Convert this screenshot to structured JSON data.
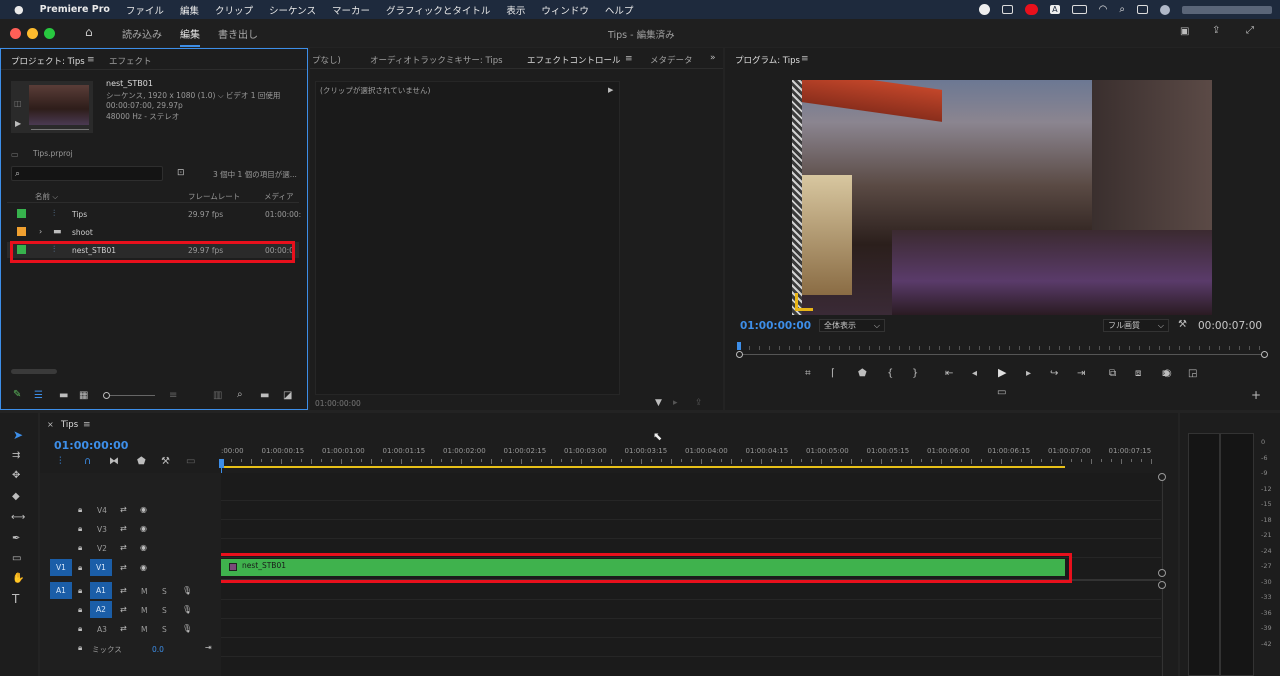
{
  "menubar": {
    "app_name": "Premiere Pro",
    "items": [
      "ファイル",
      "編集",
      "クリップ",
      "シーケンス",
      "マーカー",
      "グラフィックとタイトル",
      "表示",
      "ウィンドウ",
      "ヘルプ"
    ],
    "input_badge": "A"
  },
  "titlebar": {
    "tabs": [
      "読み込み",
      "編集",
      "書き出し"
    ],
    "active_tab": 1,
    "document_title": "Tips - 編集済み"
  },
  "project_panel": {
    "tab_label": "プロジェクト: Tips",
    "effects_tab": "エフェクト",
    "clip_name": "nest_STB01",
    "clip_info_line1": "シーケンス, 1920 x 1080 (1.0) ⌵ ビデオ 1 回使用",
    "clip_info_line2": "00:00:07:00, 29.97p",
    "clip_info_line3": "48000 Hz - ステレオ",
    "project_file": "Tips.prproj",
    "search_placeholder": "",
    "selection_status": "3 個中 1 個の項目が選...",
    "columns": {
      "name": "名前",
      "frame_rate": "フレームレート",
      "media": "メディア"
    },
    "rows": [
      {
        "name": "Tips",
        "fps": "29.97 fps",
        "media": "01:00:00:",
        "color": "#37b24d",
        "kind": "sequence"
      },
      {
        "name": "shoot",
        "fps": "",
        "media": "",
        "color": "#f0a030",
        "kind": "bin"
      },
      {
        "name": "nest_STB01",
        "fps": "29.97 fps",
        "media": "00:00:0",
        "color": "#37b24d",
        "kind": "sequence",
        "selected": true
      }
    ]
  },
  "middle_panel": {
    "tabs": [
      "プなし)",
      "オーディオトラックミキサー: Tips",
      "エフェクトコントロール",
      "メタデータ"
    ],
    "active_tab": 2,
    "no_clip_message": "(クリップが選択されていません)",
    "timecode": "01:00:00:00"
  },
  "program_monitor": {
    "tab_label": "プログラム: Tips",
    "timecode_current": "01:00:00:00",
    "zoom_select": "全体表示",
    "quality_select": "フル画質",
    "timecode_duration": "00:00:07:00"
  },
  "timeline": {
    "tab_label": "Tips",
    "timecode": "01:00:00:00",
    "ruler_labels": [
      ":00:00",
      "01:00:00:15",
      "01:00:01:00",
      "01:00:01:15",
      "01:00:02:00",
      "01:00:02:15",
      "01:00:03:00",
      "01:00:03:15",
      "01:00:04:00",
      "01:00:04:15",
      "01:00:05:00",
      "01:00:05:15",
      "01:00:06:00",
      "01:00:06:15",
      "01:00:07:00",
      "01:00:07:15"
    ],
    "video_tracks": [
      "V4",
      "V3",
      "V2",
      "V1"
    ],
    "audio_tracks": [
      "A1",
      "A2",
      "A3"
    ],
    "source_v": "V1",
    "source_a": "A1",
    "mix_label": "ミックス",
    "mix_value": "0.0",
    "clip_name": "nest_STB01",
    "mute_label": "M",
    "solo_label": "S"
  },
  "audio_meter": {
    "ticks": [
      "0",
      "-6",
      "-9",
      "-12",
      "-15",
      "-18",
      "-21",
      "-24",
      "-27",
      "-30",
      "-33",
      "-36",
      "-39",
      "-42"
    ]
  },
  "colors": {
    "accent": "#3d8ee8",
    "selection_red": "#e8101c",
    "clip_green": "#3fb24d",
    "timecode_blue": "#3d8ee8"
  }
}
